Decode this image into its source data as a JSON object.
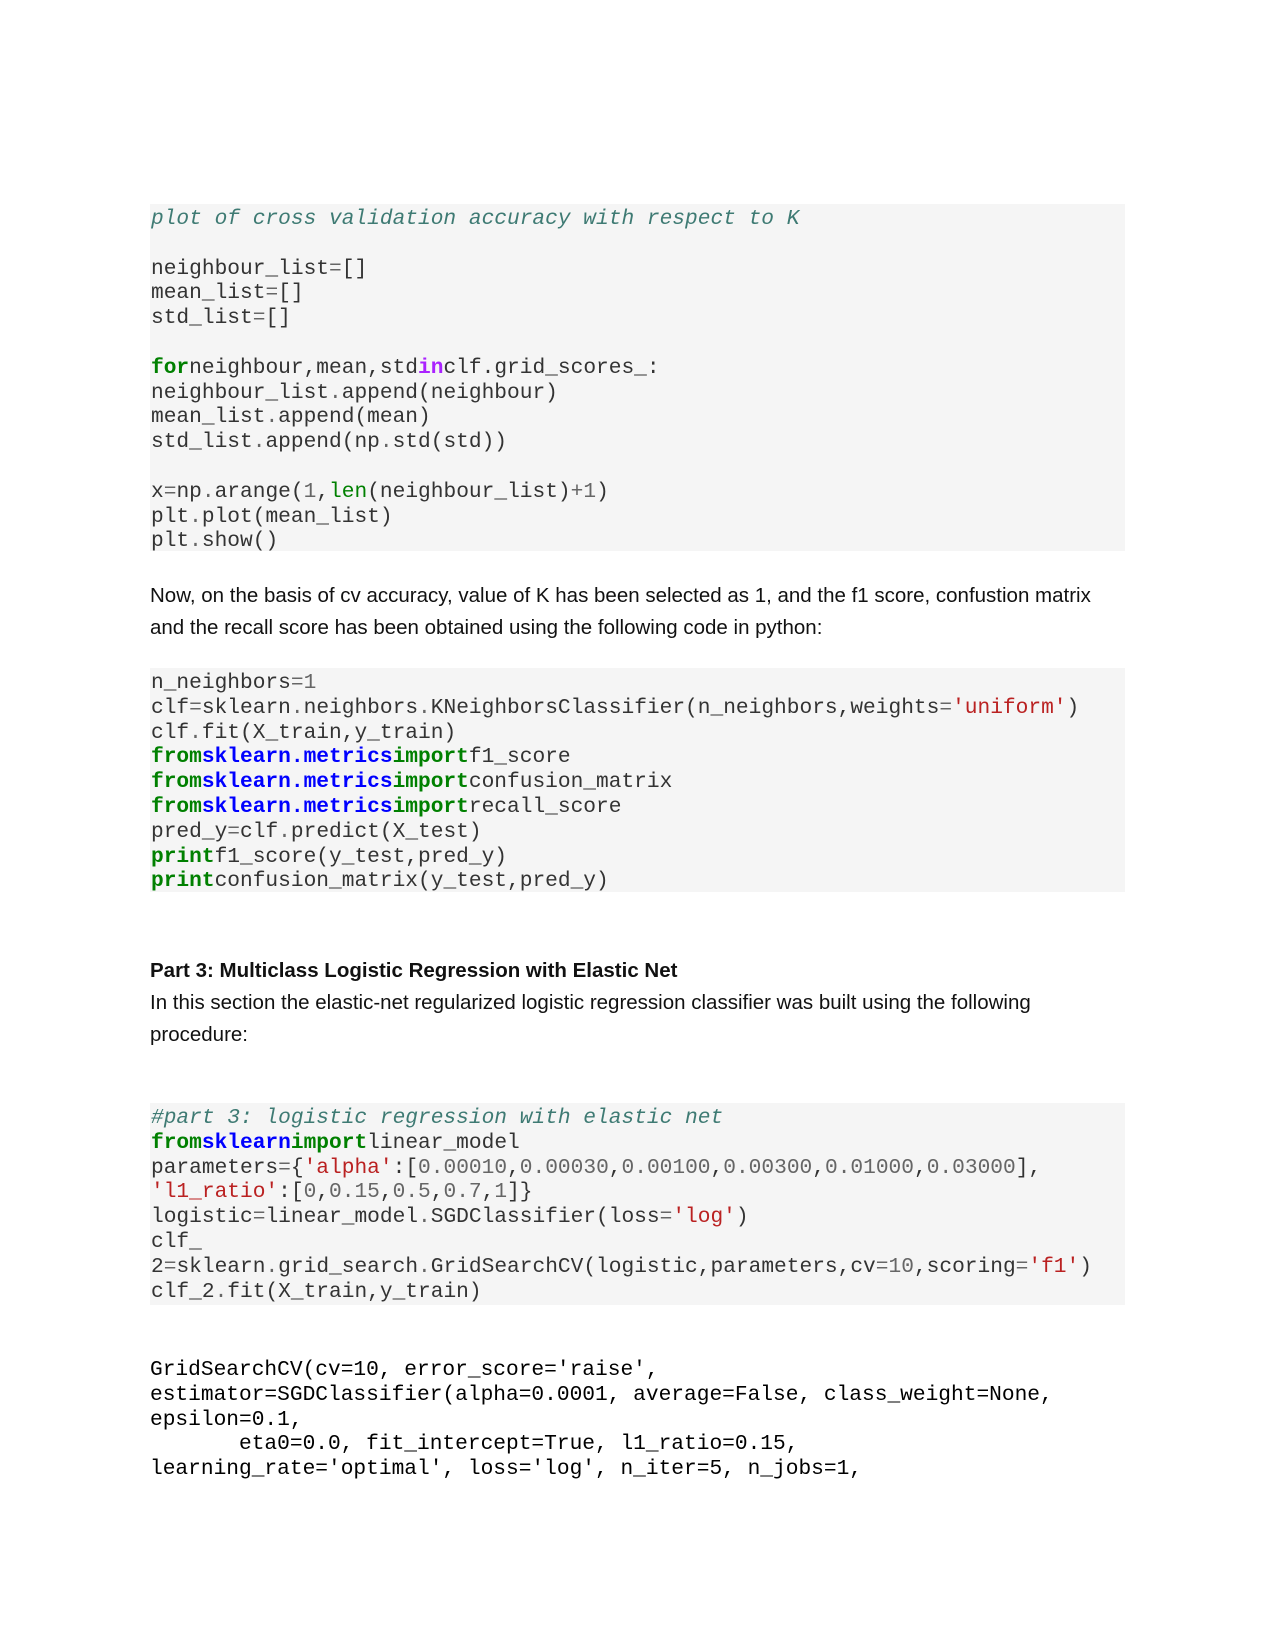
{
  "code_block_1": {
    "comment": "plot of cross validation accuracy with respect to K",
    "l1": "neighbour_list",
    "l1b": "[]",
    "l2": "mean_list",
    "l2b": "[]",
    "l3": "std_list",
    "l3b": "[]",
    "for_kw": "for",
    "for_vars": "neighbour,mean,std",
    "in_kw": "in",
    "for_rest": "clf.grid_scores_:",
    "l5a": "neighbour_list",
    "l5b": ".",
    "l5c": "append(neighbour)",
    "l6a": "mean_list",
    "l6b": ".",
    "l6c": "append(mean)",
    "l7a": "std_list",
    "l7b": ".",
    "l7c": "append(np",
    "l7d": ".",
    "l7e": "std(std))",
    "l8a": "x",
    "l8b": "=",
    "l8c": "np",
    "l8d": ".",
    "l8e": "arange(",
    "l8f": "1",
    "l8g": ",",
    "l8h": "len",
    "l8i": "(neighbour_list)",
    "l8j": "+1",
    "l8k": ")",
    "l9a": "plt",
    "l9b": ".",
    "l9c": "plot(mean_list)",
    "l10a": "plt",
    "l10b": ".",
    "l10c": "show()"
  },
  "paragraph_1": "Now, on the basis of cv accuracy, value of K has been selected as 1, and the f1 score, confustion matrix and the recall score has been obtained using the following code in python:",
  "code_block_2": {
    "l1a": "n_neighbors",
    "l1b": "=",
    "l1c": "1",
    "l2a": "clf",
    "l2b": "=",
    "l2c": "sklearn",
    "l2d": ".",
    "l2e": "neighbors",
    "l2f": ".",
    "l2g": "KNeighborsClassifier(n_neighbors,weights",
    "l2h": "=",
    "l2i": "'uniform'",
    "l2j": ")",
    "l3a": "clf",
    "l3b": ".",
    "l3c": "fit(X_train,y_train)",
    "from": "from",
    "module": "sklearn.metrics",
    "import": "import",
    "imp1": "f1_score",
    "imp2": "confusion_matrix",
    "imp3": "recall_score",
    "l7a": "pred_y",
    "l7b": "=",
    "l7c": "clf",
    "l7d": ".",
    "l7e": "predict(X_test)",
    "print": "print",
    "p1": "f1_score(y_test,pred_y)",
    "p2": "confusion_matrix(y_test,pred_y)"
  },
  "section_heading": "Part 3: Multiclass Logistic Regression with Elastic Net",
  "paragraph_2": "In this section the elastic-net regularized logistic regression classifier was built using the following procedure:",
  "code_block_3": {
    "comment": "#part 3: logistic regression with elastic net",
    "from": "from",
    "module": "sklearn",
    "import": "import",
    "imported": "linear_model",
    "l3a": "parameters",
    "l3b": "=",
    "l3c": "{",
    "l3d": "'alpha'",
    "l3e": ":[",
    "alphas": [
      "0.00010",
      "0.00030",
      "0.00100",
      "0.00300",
      "0.01000",
      "0.03000"
    ],
    "comma": ",",
    "l3end": "],",
    "l4a": "'l1_ratio'",
    "l4b": ":[",
    "l1_ratios": [
      "0",
      "0.15",
      "0.5",
      "0.7",
      "1"
    ],
    "l4end": "]}",
    "l5a": "logistic",
    "l5b": "=",
    "l5c": "linear_model",
    "l5d": ".",
    "l5e": "SGDClassifier(loss",
    "l5f": "=",
    "l5g": "'log'",
    "l5h": ")",
    "l6": "clf_",
    "l7a": "2",
    "l7b": "=",
    "l7c": "sklearn",
    "l7d": ".",
    "l7e": "grid_search",
    "l7f": ".",
    "l7g": "GridSearchCV(logistic,parameters,cv",
    "l7h": "=",
    "l7i": "10",
    "l7j": ",scoring",
    "l7k": "=",
    "l7l": "'f1'",
    "l7m": ")",
    "l8a": "clf_2",
    "l8b": ".",
    "l8c": "fit(X_train,y_train)"
  },
  "output_block": {
    "lines": [
      "GridSearchCV(cv=10, error_score='raise',",
      "estimator=SGDClassifier(alpha=0.0001, average=False, class_weight=None,",
      "epsilon=0.1,",
      "       eta0=0.0, fit_intercept=True, l1_ratio=0.15,",
      "learning_rate='optimal', loss='log', n_iter=5, n_jobs=1,"
    ]
  }
}
